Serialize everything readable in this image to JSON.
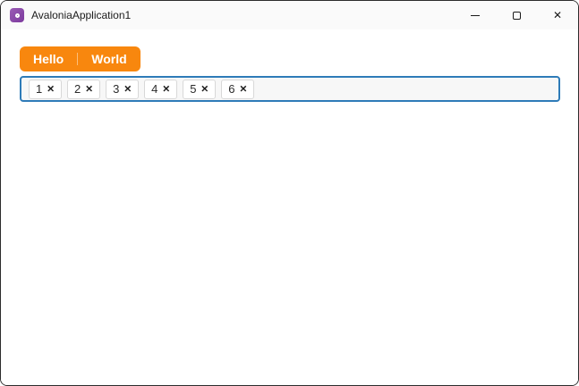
{
  "window": {
    "title": "AvaloniaApplication1",
    "controls": {
      "close_glyph": "✕"
    },
    "icons": {
      "app_icon": "avalonia-logo",
      "minimize": "minimize-dash",
      "maximize": "maximize-square",
      "close": "close-x"
    }
  },
  "toolbar": {
    "buttons": [
      {
        "label": "Hello"
      },
      {
        "label": "World"
      }
    ]
  },
  "chip_input": {
    "chips": [
      {
        "label": "1",
        "remove_glyph": "✕"
      },
      {
        "label": "2",
        "remove_glyph": "✕"
      },
      {
        "label": "3",
        "remove_glyph": "✕"
      },
      {
        "label": "4",
        "remove_glyph": "✕"
      },
      {
        "label": "5",
        "remove_glyph": "✕"
      },
      {
        "label": "6",
        "remove_glyph": "✕"
      }
    ]
  },
  "colors": {
    "accent_orange": "#F8870E",
    "focus_border": "#2E7BB8",
    "logo_purple": "#8B44AC",
    "titlebar_bg": "#FAFAFA"
  }
}
